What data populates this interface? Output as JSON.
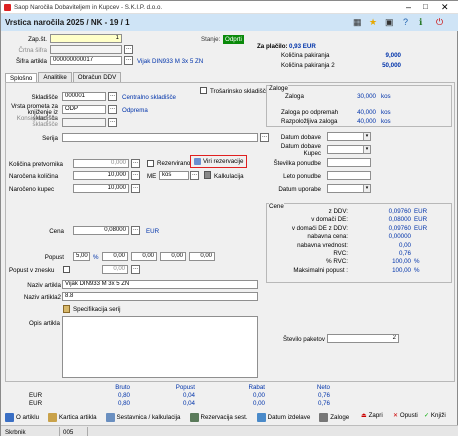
{
  "window": {
    "title": "Saop   Naročila Dobaviteljem in Kupcev  - S.K.I.P. d.o.o."
  },
  "header": {
    "title": "Vrstica naročila 2025 / NK - 19 / 1",
    "status_label": "Stanje:",
    "status_value": "Odprti",
    "za_placilo_label": "Za plačilo:",
    "za_placilo_value": "0,93 EUR",
    "kolicina_pakiranja_label": "Količina pakiranja",
    "kolicina_pakiranja_value": "9,000",
    "kolicina_pakiranja2_label": "Količina pakiranja 2",
    "kolicina_pakiranja2_value": "50,000"
  },
  "top": {
    "zapst_label": "Zap.št.",
    "zapst_value": "1",
    "crtna_label": "Črtna šifra",
    "crtna_value": "",
    "sifra_label": "Šifra artikla",
    "sifra_value": "000000000017",
    "article_name": "Vijak DIN933 M 3x 5 ZN"
  },
  "tabs": [
    "Splošno",
    "Analitike",
    "Obračun DDV"
  ],
  "general": {
    "skladisce_label": "Skladišče",
    "skladisce_value": "000001",
    "skladisce_name": "Centralno skladišče",
    "trosarinsko_label": "Trošarinsko skladišče",
    "vrsta_label": "Vrsta prometa za knjiženje iz skladišča",
    "vrsta_value": "ODP",
    "vrsta_name": "Odprema",
    "konsig_label": "Konsignacijsko skladišče",
    "serija_label": "Serija",
    "kolicina_pretvornika_label": "Količina pretvornika",
    "kolicina_pretvornika_value": "0,000",
    "rezervirano_label": "Rezervirano",
    "viri_label": "Viri rezervacije",
    "narocena_kolicina_label": "Naročena količina",
    "narocena_kolicina_value": "10,000",
    "me_label": "ME",
    "me_value": "kos",
    "kalkulacija_label": "Kalkulacija",
    "naroceno_kupec_label": "Naročeno kupec",
    "naroceno_kupec_value": "10,000",
    "cena_label": "Cena",
    "cena_value": "0,08000",
    "cena_currency": "EUR",
    "popust_label": "Popust",
    "popust_values": [
      "5,00",
      "0,00",
      "0,00",
      "0,00",
      "0,00"
    ],
    "popust_pct": "%",
    "popust_znesku_label": "Popust v znesku",
    "popust_znesku_value": "0,00",
    "naziv1_label": "Naziv artikla",
    "naziv1_value": "Vijak DIN933 M 3x 5 ZN",
    "naziv2_label": "Naziv artikla2",
    "naziv2_value": "8.8",
    "specifikacija_label": "Specifikacija serij",
    "opis_label": "Opis artikla"
  },
  "zaloge": {
    "title": "Zaloge",
    "zaloga_label": "Zaloga",
    "zaloga_value": "30,000",
    "zaloga_unit": "kos",
    "odprema_label": "Zaloga po odpremah",
    "odprema_value": "40,000",
    "odprema_unit": "kos",
    "razpolozljiva_label": "Razpoložljiva zaloga",
    "razpolozljiva_value": "40,000",
    "razpolozljiva_unit": "kos"
  },
  "dates": {
    "datum_dobave_label": "Datum dobave",
    "datum_dobave_kupec_label": "Datum dobave Kupec",
    "stevilka_ponudbe_label": "Številka ponudbe",
    "leto_ponudbe_label": "Leto ponudbe",
    "datum_uporabe_label": "Datum uporabe"
  },
  "cene": {
    "title": "Cene",
    "rows": [
      {
        "label": "z DDV:",
        "value": "0,09760",
        "unit": "EUR"
      },
      {
        "label": "v domači DE:",
        "value": "0,08000",
        "unit": "EUR"
      },
      {
        "label": "v domači DE z DDV:",
        "value": "0,09760",
        "unit": "EUR"
      },
      {
        "label": "nabavna cena:",
        "value": "0,00000",
        "unit": ""
      },
      {
        "label": "nabavna vrednost:",
        "value": "0,00",
        "unit": ""
      },
      {
        "label": "RVC:",
        "value": "0,76",
        "unit": ""
      },
      {
        "label": "% RVC:",
        "value": "100,00",
        "unit": "%"
      },
      {
        "label": "Maksimalni popust :",
        "value": "100,00",
        "unit": "%"
      }
    ]
  },
  "paketi": {
    "label": "Število paketov",
    "value": "2"
  },
  "totals": {
    "headers": [
      "Bruto",
      "Popust",
      "Rabat",
      "Neto"
    ],
    "rows": [
      {
        "cur": "EUR",
        "values": [
          "0,80",
          "0,04",
          "0,00",
          "0,76"
        ]
      },
      {
        "cur": "EUR",
        "values": [
          "0,80",
          "0,04",
          "0,00",
          "0,76"
        ]
      }
    ]
  },
  "toolbar": {
    "o_artiklu": "O artiklu",
    "kartica": "Kartica artikla",
    "sestavnica": "Sestavnica / kalkulacija",
    "rezervacija": "Rezervacija sest.",
    "datum_izdelave": "Datum izdelave",
    "zaloge": "Zaloge",
    "zapri": "Zapri",
    "opusti": "Opusti",
    "knjizi": "Knjiži"
  },
  "statusbar": {
    "user": "Skrbnik",
    "code": "005"
  }
}
